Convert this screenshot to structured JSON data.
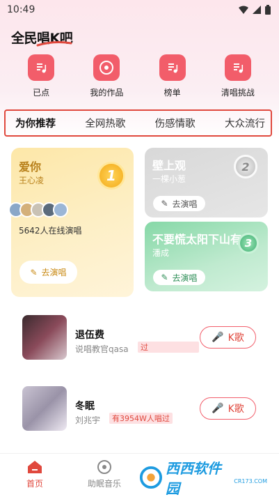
{
  "status_bar": {
    "time": "10:49"
  },
  "app": {
    "logo": "全民唱K吧"
  },
  "quick_actions": [
    {
      "label": "已点",
      "icon": "music-note-icon"
    },
    {
      "label": "我的作品",
      "icon": "disc-icon"
    },
    {
      "label": "榜单",
      "icon": "music-note-icon"
    },
    {
      "label": "清唱挑战",
      "icon": "music-note-icon"
    }
  ],
  "tabs": [
    "为你推荐",
    "全网热歌",
    "伤感情歌",
    "大众流行"
  ],
  "top_cards": [
    {
      "rank": "1",
      "title": "爱你",
      "artist": "王心凌",
      "online_text": "5642人在线演唱",
      "button": "去演唱"
    },
    {
      "rank": "2",
      "title": "壁上观",
      "artist": "一棵小葱",
      "button": "去演唱"
    },
    {
      "rank": "3",
      "title": "不要慌太阳下山有月",
      "artist": "潘成",
      "button": "去演唱"
    }
  ],
  "songs": [
    {
      "title": "退伍费",
      "artist": "说唱教官qasa",
      "tag": "过",
      "button": "K歌"
    },
    {
      "title": "冬眠",
      "artist": "刘兆宇",
      "tag": "有3954W人唱过",
      "button": "K歌"
    }
  ],
  "bottom_nav": [
    {
      "label": "首页",
      "active": true
    },
    {
      "label": "助眠音乐",
      "active": false
    }
  ],
  "watermark": {
    "text": "西西软件园",
    "url": "CR173.COM"
  },
  "colors": {
    "accent": "#f25d6a",
    "tab_border": "#e0483d"
  }
}
